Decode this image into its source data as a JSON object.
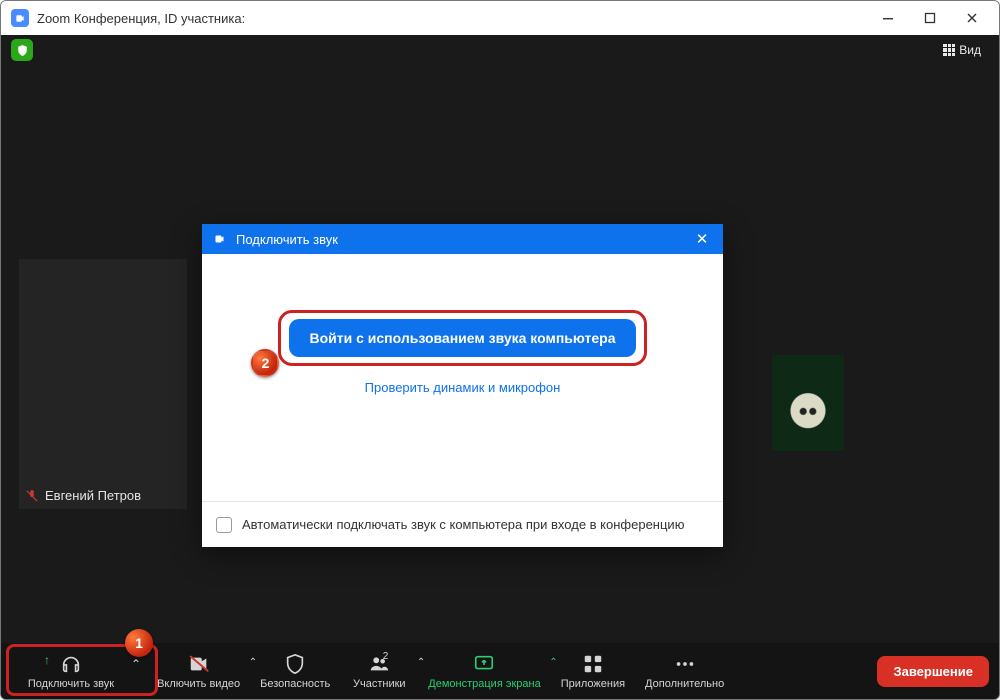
{
  "window": {
    "title": "Zoom Конференция, ID участника:"
  },
  "topbar": {
    "view_label": "Вид"
  },
  "participant_self": {
    "name": "Евгений Петров"
  },
  "dialog": {
    "title": "Подключить звук",
    "primary_button": "Войти с использованием звука компьютера",
    "test_link": "Проверить динамик и микрофон",
    "auto_connect_label": "Автоматически подключать звук с компьютера при входе в конференцию"
  },
  "toolbar": {
    "audio": "Подключить звук",
    "video": "Включить видео",
    "security": "Безопасность",
    "participants": "Участники",
    "participants_count": "2",
    "share": "Демонстрация экрана",
    "apps": "Приложения",
    "more": "Дополнительно",
    "end": "Завершение"
  },
  "annotations": {
    "step1": "1",
    "step2": "2"
  }
}
